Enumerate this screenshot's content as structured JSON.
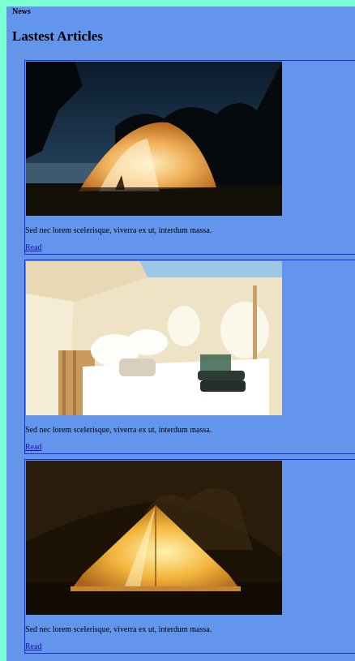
{
  "header": {
    "nav_label": "News"
  },
  "main": {
    "title": "Lastest Articles",
    "articles": [
      {
        "image": "tent-at-night-lake",
        "excerpt": "Sed nec lorem scelerisque, viverra ex ut, interdum massa.",
        "link_label": "Read"
      },
      {
        "image": "glamping-tent-bed-interior",
        "excerpt": "Sed nec lorem scelerisque, viverra ex ut, interdum massa.",
        "link_label": "Read"
      },
      {
        "image": "bell-tent-lit-forest",
        "excerpt": "Sed nec lorem scelerisque, viverra ex ut, interdum massa.",
        "link_label": "Read"
      }
    ]
  },
  "colors": {
    "outer_background": "#7fffd4",
    "page_background": "#6495ed",
    "card_border": "#1e2ccc",
    "link": "#1a0dab"
  }
}
